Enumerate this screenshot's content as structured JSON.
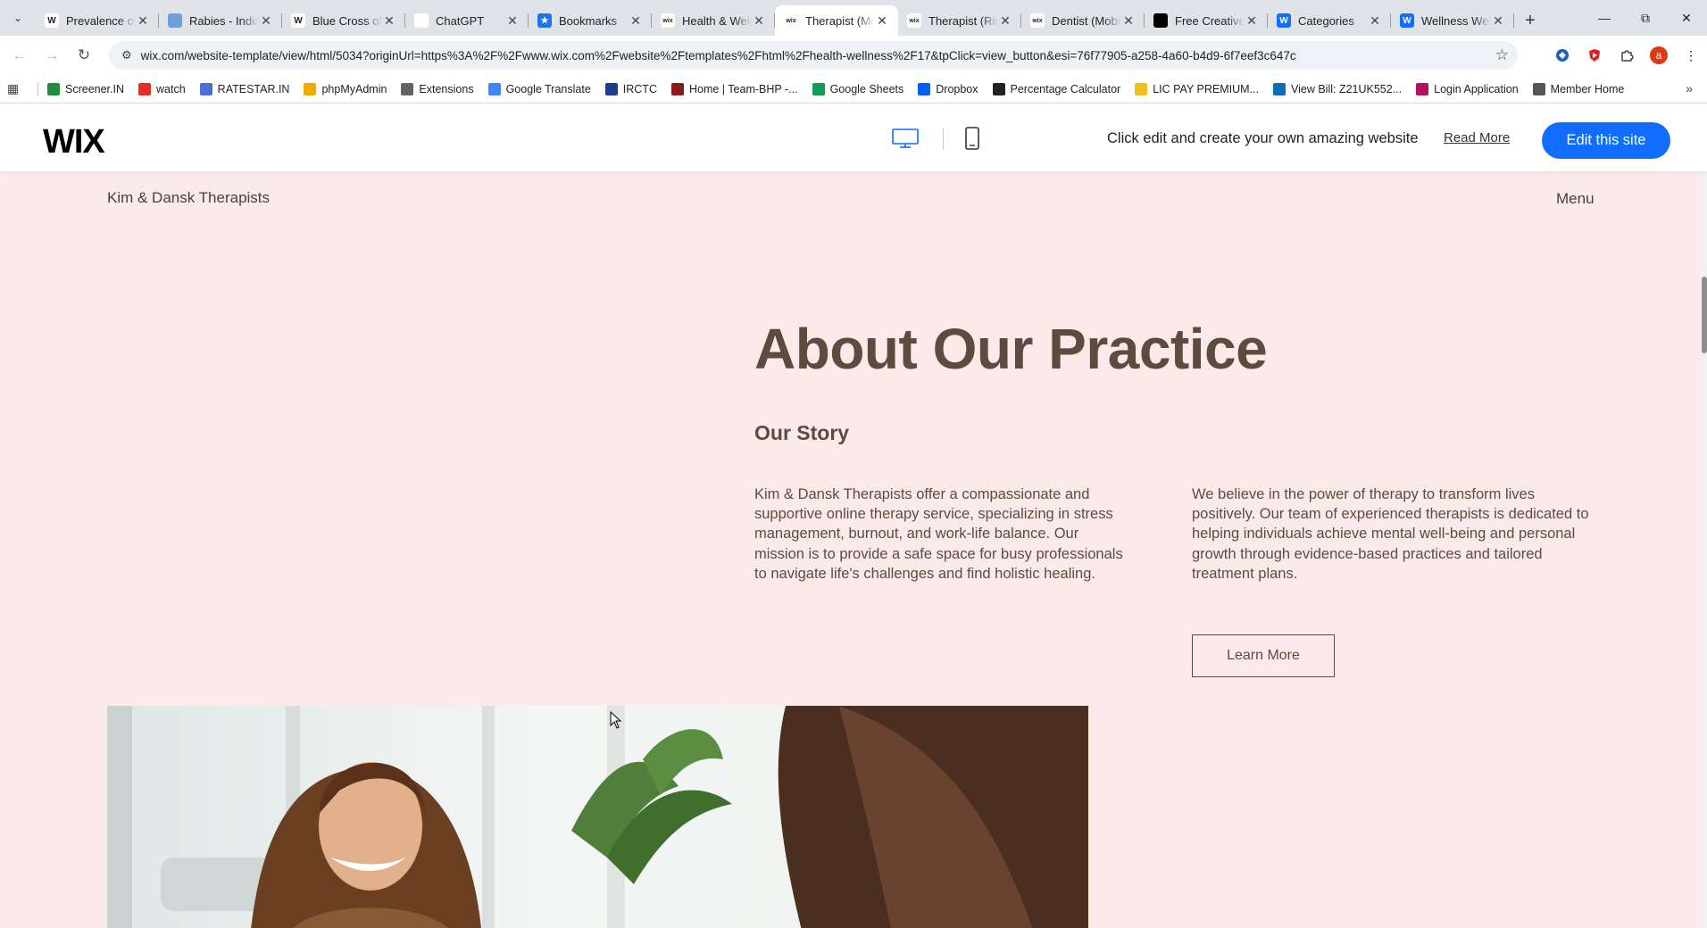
{
  "browser": {
    "tabs": [
      {
        "title": "Prevalence of",
        "favicon": "wikipedia-icon",
        "fav_color": "#ffffff",
        "fav_text": "W"
      },
      {
        "title": "Rabies - India",
        "favicon": "globe-icon",
        "fav_color": "#6d9fd9",
        "fav_text": ""
      },
      {
        "title": "Blue Cross of",
        "favicon": "wikipedia-icon",
        "fav_color": "#ffffff",
        "fav_text": "W"
      },
      {
        "title": "ChatGPT",
        "favicon": "chatgpt-icon",
        "fav_color": "#ffffff",
        "fav_text": ""
      },
      {
        "title": "Bookmarks",
        "favicon": "star-icon",
        "fav_color": "#1a73e8",
        "fav_text": "★"
      },
      {
        "title": "Health & Wellness",
        "favicon": "wix-icon",
        "fav_color": "#ffffff",
        "fav_text": "wix"
      },
      {
        "title": "Therapist (Mobile)",
        "favicon": "wix-icon",
        "fav_color": "#ffffff",
        "fav_text": "wix",
        "active": true
      },
      {
        "title": "Therapist (Rich)",
        "favicon": "wix-icon",
        "fav_color": "#ffffff",
        "fav_text": "wix"
      },
      {
        "title": "Dentist (Mobile)",
        "favicon": "wix-icon",
        "fav_color": "#ffffff",
        "fav_text": "wix"
      },
      {
        "title": "Free Creative",
        "favicon": "framer-icon",
        "fav_color": "#000000",
        "fav_text": ""
      },
      {
        "title": "Categories",
        "favicon": "wix-blue-icon",
        "fav_color": "#116dff",
        "fav_text": "W"
      },
      {
        "title": "Wellness Website",
        "favicon": "wix-blue-icon",
        "fav_color": "#116dff",
        "fav_text": "W"
      }
    ],
    "url": "wix.com/website-template/view/html/5034?originUrl=https%3A%2F%2Fwww.wix.com%2Fwebsite%2Ftemplates%2Fhtml%2Fhealth-wellness%2F17&tpClick=view_button&esi=76f77905-a258-4a60-b4d9-6f7eef3c647c",
    "profile_initial": "a",
    "bookmarks": [
      {
        "label": "Screener.IN",
        "color": "#1e8e3e"
      },
      {
        "label": "watch",
        "color": "#e52d27"
      },
      {
        "label": "RATESTAR.IN",
        "color": "#4a6fd8"
      },
      {
        "label": "phpMyAdmin",
        "color": "#f2a900"
      },
      {
        "label": "Extensions",
        "color": "#5f6368"
      },
      {
        "label": "Google Translate",
        "color": "#4285f4"
      },
      {
        "label": "IRCTC",
        "color": "#1f3d8a"
      },
      {
        "label": "Home | Team-BHP -...",
        "color": "#8b1a1a"
      },
      {
        "label": "Google Sheets",
        "color": "#0f9d58"
      },
      {
        "label": "Dropbox",
        "color": "#0061fe"
      },
      {
        "label": "Percentage Calculator",
        "color": "#222222"
      },
      {
        "label": "LIC PAY PREMIUM...",
        "color": "#f0c020"
      },
      {
        "label": "View Bill: Z21UK552...",
        "color": "#0b6fb8"
      },
      {
        "label": "Login Application",
        "color": "#b0125b"
      },
      {
        "label": "Member Home",
        "color": "#555555"
      }
    ]
  },
  "wixbar": {
    "logo": "WIX",
    "tagline": "Click edit and create your own amazing website",
    "read_more": "Read More",
    "edit_button": "Edit this site",
    "accent": "#116dff"
  },
  "site": {
    "brand": "Kim & Dansk Therapists",
    "menu": "Menu",
    "title": "About Our Practice",
    "subtitle": "Our Story",
    "paragraph1": "Kim & Dansk Therapists offer a compassionate and supportive online therapy service, specializing in stress management, burnout, and work-life balance. Our mission is to provide a safe space for busy professionals to navigate life's challenges and find holistic healing.",
    "paragraph2": "We believe in the power of therapy to transform lives positively. Our team of experienced therapists is dedicated to helping individuals achieve mental well-being and personal growth through evidence-based practices and tailored treatment plans.",
    "learn_more": "Learn More",
    "background": "#fbeaea",
    "text_color": "#5c4b3e"
  }
}
